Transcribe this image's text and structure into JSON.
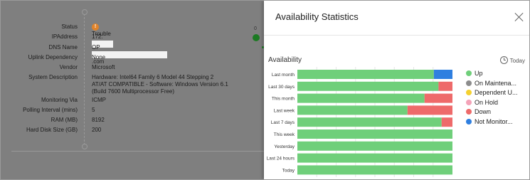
{
  "device": {
    "rows": [
      {
        "key": "Status",
        "value": "Trouble",
        "icon": "warning-icon"
      },
      {
        "key": "IPAddress",
        "value": "172."
      },
      {
        "key": "DNS Name",
        "value": "OP",
        "suffix": ".com"
      },
      {
        "key": "Uplink Dependency",
        "value": "None"
      },
      {
        "key": "Vendor",
        "value": "Microsoft"
      },
      {
        "key": "System Description",
        "lines": [
          "Hardware: Intel64 Family 6 Model 44 Stepping 2",
          "AT/AT COMPATIBLE - Software: Windows Version 6.1",
          "(Build 7600 Multiprocessor Free)"
        ]
      },
      {
        "key": "Monitoring Via",
        "value": "ICMP"
      },
      {
        "key": "Polling Interval (mins)",
        "value": "5"
      },
      {
        "key": "RAM (MB)",
        "value": "8192"
      },
      {
        "key": "Hard Disk Size (GB)",
        "value": "200"
      }
    ],
    "node_label": "0"
  },
  "panel": {
    "title": "Availability Statistics",
    "section_title": "Availability",
    "today_label": "Today",
    "close_icon": "close-icon",
    "clock_icon": "clock-icon"
  },
  "chart_data": {
    "type": "bar",
    "orientation": "horizontal",
    "stacked": true,
    "title": "Availability",
    "categories": [
      "Last month",
      "Last 30 days",
      "This month",
      "Last week",
      "Last 7 days",
      "This week",
      "Yesterday",
      "Last 24 hours",
      "Today"
    ],
    "series": [
      {
        "name": "Up",
        "color": "#6fcf7a",
        "values": [
          88,
          91,
          82,
          71,
          93,
          100,
          100,
          100,
          100
        ]
      },
      {
        "name": "On Maintena...",
        "color": "#8c8c8c",
        "values": [
          0,
          0,
          0,
          0,
          0,
          0,
          0,
          0,
          0
        ]
      },
      {
        "name": "Dependent U...",
        "color": "#f5d130",
        "values": [
          0,
          0,
          0,
          0,
          0,
          0,
          0,
          0,
          0
        ]
      },
      {
        "name": "On Hold",
        "color": "#f4a3b8",
        "values": [
          0,
          0,
          0,
          0,
          0,
          0,
          0,
          0,
          0
        ]
      },
      {
        "name": "Down",
        "color": "#ee6a6a",
        "values": [
          0,
          9,
          18,
          29,
          7,
          0,
          0,
          0,
          0
        ]
      },
      {
        "name": "Not Monitor...",
        "color": "#2f7fe0",
        "values": [
          12,
          0,
          0,
          0,
          0,
          0,
          0,
          0,
          0
        ]
      }
    ],
    "xlim": [
      0,
      100
    ],
    "grid": true,
    "legend_position": "right"
  }
}
